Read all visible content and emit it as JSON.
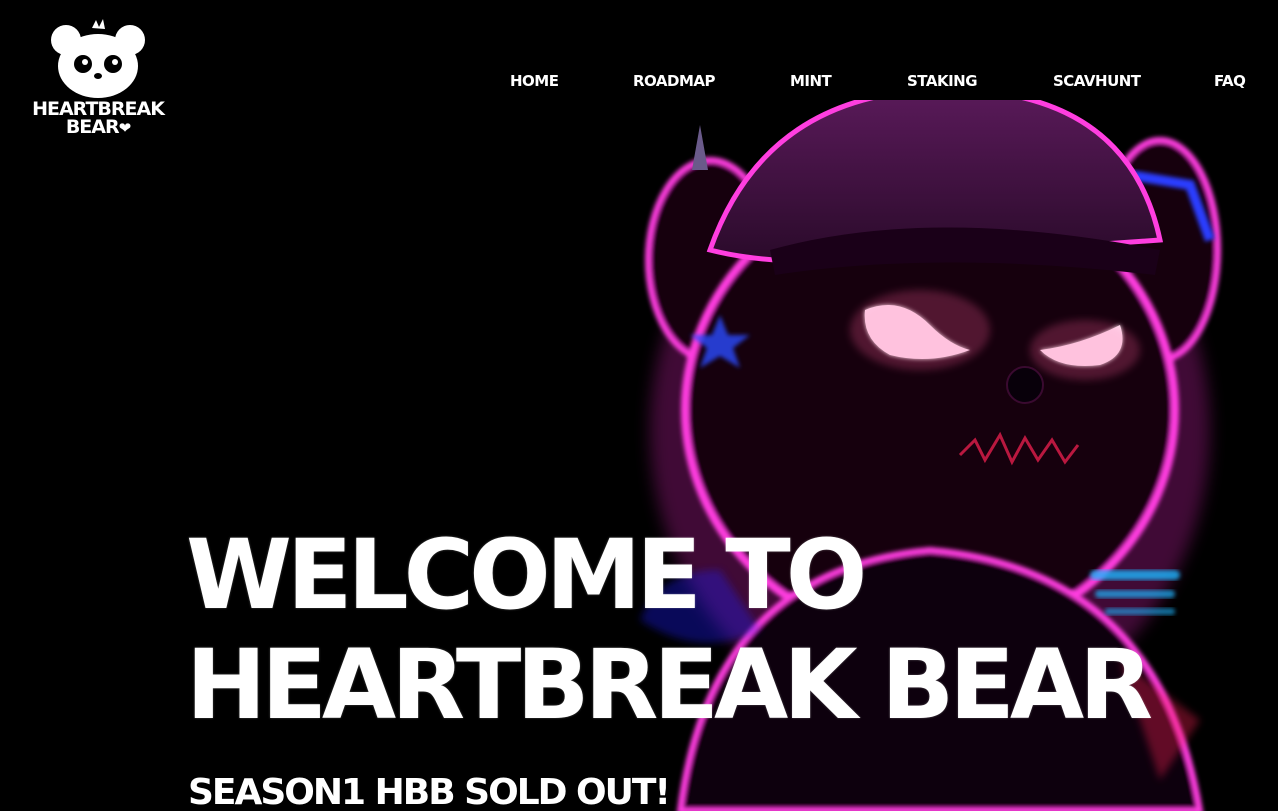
{
  "logo": {
    "line1": "HEARTBREAK",
    "line2": "BEAR",
    "heart_icon": "broken-heart-icon"
  },
  "nav": {
    "items": [
      {
        "label": "HOME"
      },
      {
        "label": "ROADMAP"
      },
      {
        "label": "MINT"
      },
      {
        "label": "STAKING"
      },
      {
        "label": "SCAVHUNT"
      },
      {
        "label": "FAQ"
      }
    ]
  },
  "hero": {
    "title_line1": "WELCOME TO",
    "title_line2": "HEARTBREAK BEAR",
    "subtitle": "SEASON1 HBB SOLD OUT!"
  },
  "colors": {
    "background": "#000000",
    "text": "#ffffff",
    "glow_magenta": "#ff2bd6",
    "glow_blue": "#3b6bff"
  }
}
